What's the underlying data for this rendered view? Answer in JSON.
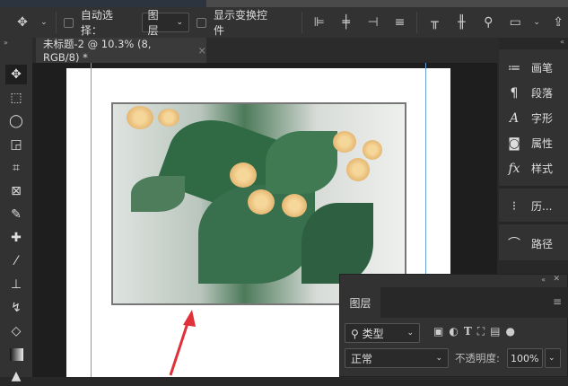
{
  "options_bar": {
    "auto_select_label": "自动选择：",
    "auto_select_value": "图层",
    "show_transform_label": "显示变换控件"
  },
  "document_tab": {
    "title": "未标题-2 @ 10.3% (8, RGB/8) *",
    "close": "×"
  },
  "right_panel": {
    "items": [
      {
        "icon": "brush-icon",
        "label": "画笔",
        "glyph": "≔"
      },
      {
        "icon": "paragraph-icon",
        "label": "段落",
        "glyph": "¶"
      },
      {
        "icon": "character-icon",
        "label": "字形",
        "glyph": "A"
      },
      {
        "icon": "properties-icon",
        "label": "属性",
        "glyph": "◙"
      },
      {
        "icon": "styles-icon",
        "label": "样式",
        "glyph": "fx"
      },
      {
        "icon": "history-icon",
        "label": "历...",
        "glyph": "⁝"
      },
      {
        "icon": "paths-icon",
        "label": "路径",
        "glyph": "⌒"
      }
    ]
  },
  "layers_panel": {
    "title": "图层",
    "filter_label": "类型",
    "blend_mode": "正常",
    "opacity_label": "不透明度:",
    "opacity_value": "100%"
  },
  "colors": {
    "accent_guide": "#6aa0d8",
    "arrow": "#e0303a"
  }
}
